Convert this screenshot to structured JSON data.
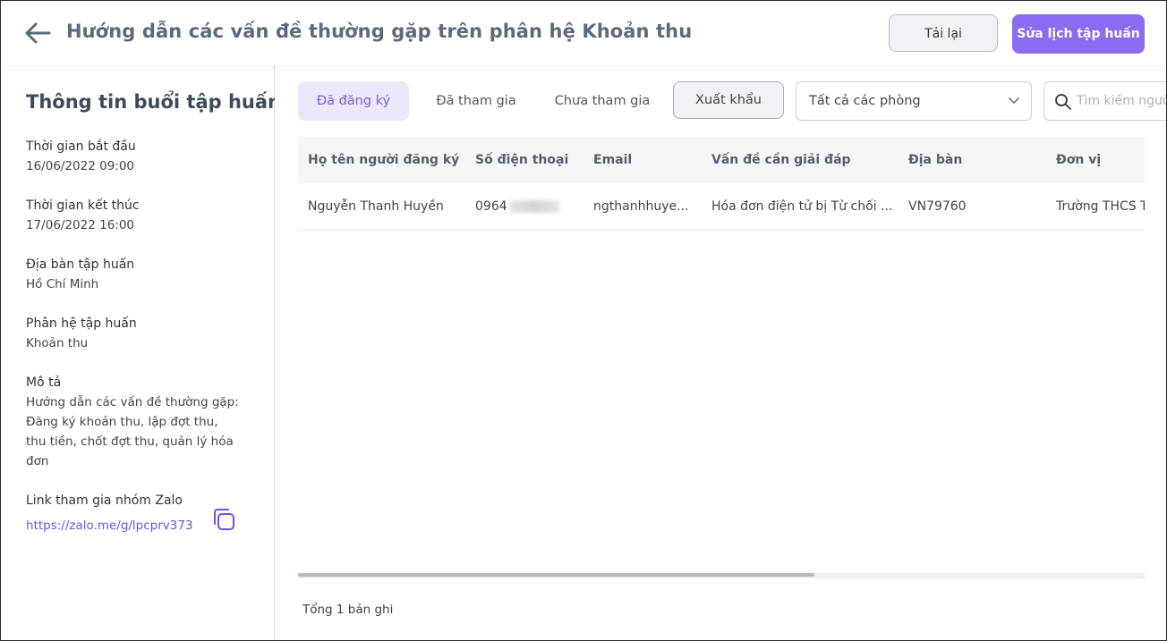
{
  "header": {
    "title": "Hướng dẫn các vấn đề thường gặp trên phân hệ Khoản thu",
    "reload_label": "Tải lại",
    "edit_label": "Sửa lịch tập huấn"
  },
  "sidebar": {
    "title": "Thông tin buổi tập huấn",
    "start_label": "Thời gian bắt đầu",
    "start_value": "16/06/2022 09:00",
    "end_label": "Thời gian kết thúc",
    "end_value": "17/06/2022 16:00",
    "area_label": "Địa bàn tập huấn",
    "area_value": "Hồ Chí Minh",
    "module_label": "Phân hệ tập huấn",
    "module_value": "Khoản thu",
    "desc_label": "Mô tả",
    "desc_value": "Hướng dẫn các vấn đề thường gặp: Đăng ký khoản thu, lập đợt thu, thu tiền, chốt đợt thu, quản lý hóa đơn",
    "zalo_label": "Link tham gia nhóm Zalo",
    "zalo_link": "https://zalo.me/g/lpcprv373"
  },
  "tabs": {
    "registered": "Đã đăng ký",
    "joined": "Đã tham gia",
    "not_joined": "Chưa tham gia"
  },
  "toolbar": {
    "export_label": "Xuất khẩu",
    "room_select_value": "Tất cả các phòng",
    "search_placeholder": "Tìm kiếm người"
  },
  "table": {
    "columns": [
      "Họ tên người đăng ký",
      "Số điện thoại",
      "Email",
      "Vấn đề cần giải đáp",
      "Địa bàn",
      "Đơn vị"
    ],
    "rows": [
      {
        "name": "Nguyễn Thanh Huyền",
        "phone": "0964",
        "email": "ngthanhhuye...",
        "issue": "Hóa đơn điện tử bị Từ chối ...",
        "area": "VN79760",
        "unit": "Trường THCS T"
      }
    ]
  },
  "footer": {
    "total_label": "Tổng 1 bản ghi"
  },
  "colors": {
    "accent": "#8b6cf0",
    "active_tab_bg": "#ebe7fb",
    "link": "#6f52e0"
  },
  "icons": {
    "back": "arrow-left-icon",
    "copy": "copy-icon",
    "collapse": "chevron-left-icon",
    "select": "chevron-down-icon",
    "search": "search-icon"
  }
}
